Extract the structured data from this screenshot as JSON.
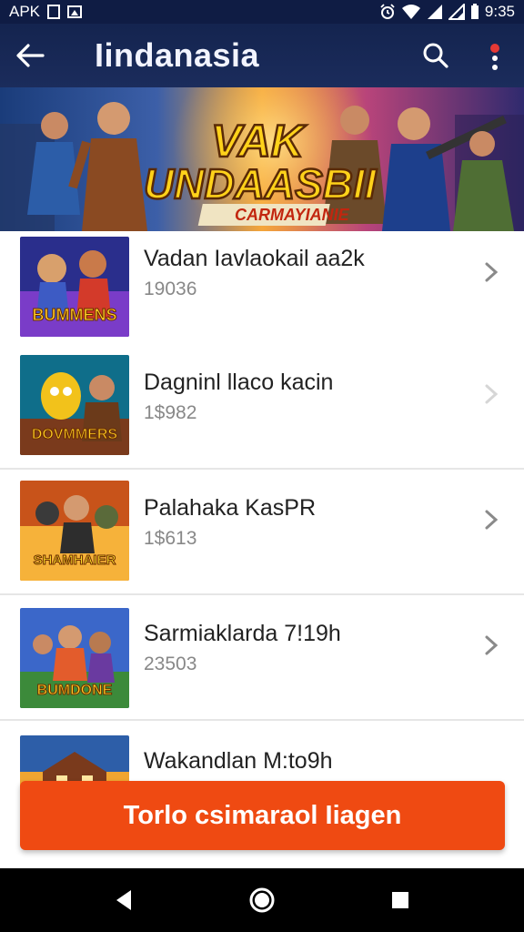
{
  "status_bar": {
    "app_label": "APK",
    "time": "9:35"
  },
  "app_bar": {
    "title": "Iindanasia"
  },
  "banner": {
    "headline_1": "VAK",
    "headline_2": "UNDAASBII",
    "tagline": "CARMAYIANIE"
  },
  "list": {
    "items": [
      {
        "title": "Vadan Iavlaokail aa2k",
        "subtitle": "19036",
        "thumb_caption": "BUMMENS",
        "thumb_colors": [
          "#2a2e8c",
          "#7a3cc8"
        ]
      },
      {
        "title": "Dagninl llaco kacin",
        "subtitle": "1$982",
        "thumb_caption": "DOVMMERS",
        "thumb_colors": [
          "#0f6e8a",
          "#f2a21b"
        ]
      },
      {
        "title": "Palahaka KasPR",
        "subtitle": "1$613",
        "thumb_caption": "SHAMHAIER",
        "thumb_colors": [
          "#c8531a",
          "#f6b23a"
        ]
      },
      {
        "title": "Sarmiaklarda 7!19h",
        "subtitle": "23503",
        "thumb_caption": "BUMDONE",
        "thumb_colors": [
          "#3b67c9",
          "#e35c2c"
        ]
      },
      {
        "title": "Wakandlan M:to9h",
        "subtitle": "",
        "thumb_caption": "",
        "thumb_colors": [
          "#2d5ea8",
          "#f0a531"
        ]
      }
    ]
  },
  "cta": {
    "label": "Torlo csimaraol Iiagen"
  },
  "colors": {
    "app_bar": "#14244f",
    "cta": "#ef4a12",
    "notification_dot": "#e53935"
  },
  "icons": {
    "back": "arrow-left-icon",
    "search": "search-icon",
    "more": "more-vertical-icon",
    "chevron": "chevron-right-icon",
    "nav_back": "triangle-back-icon",
    "nav_home": "circle-home-icon",
    "nav_recents": "square-recents-icon"
  }
}
